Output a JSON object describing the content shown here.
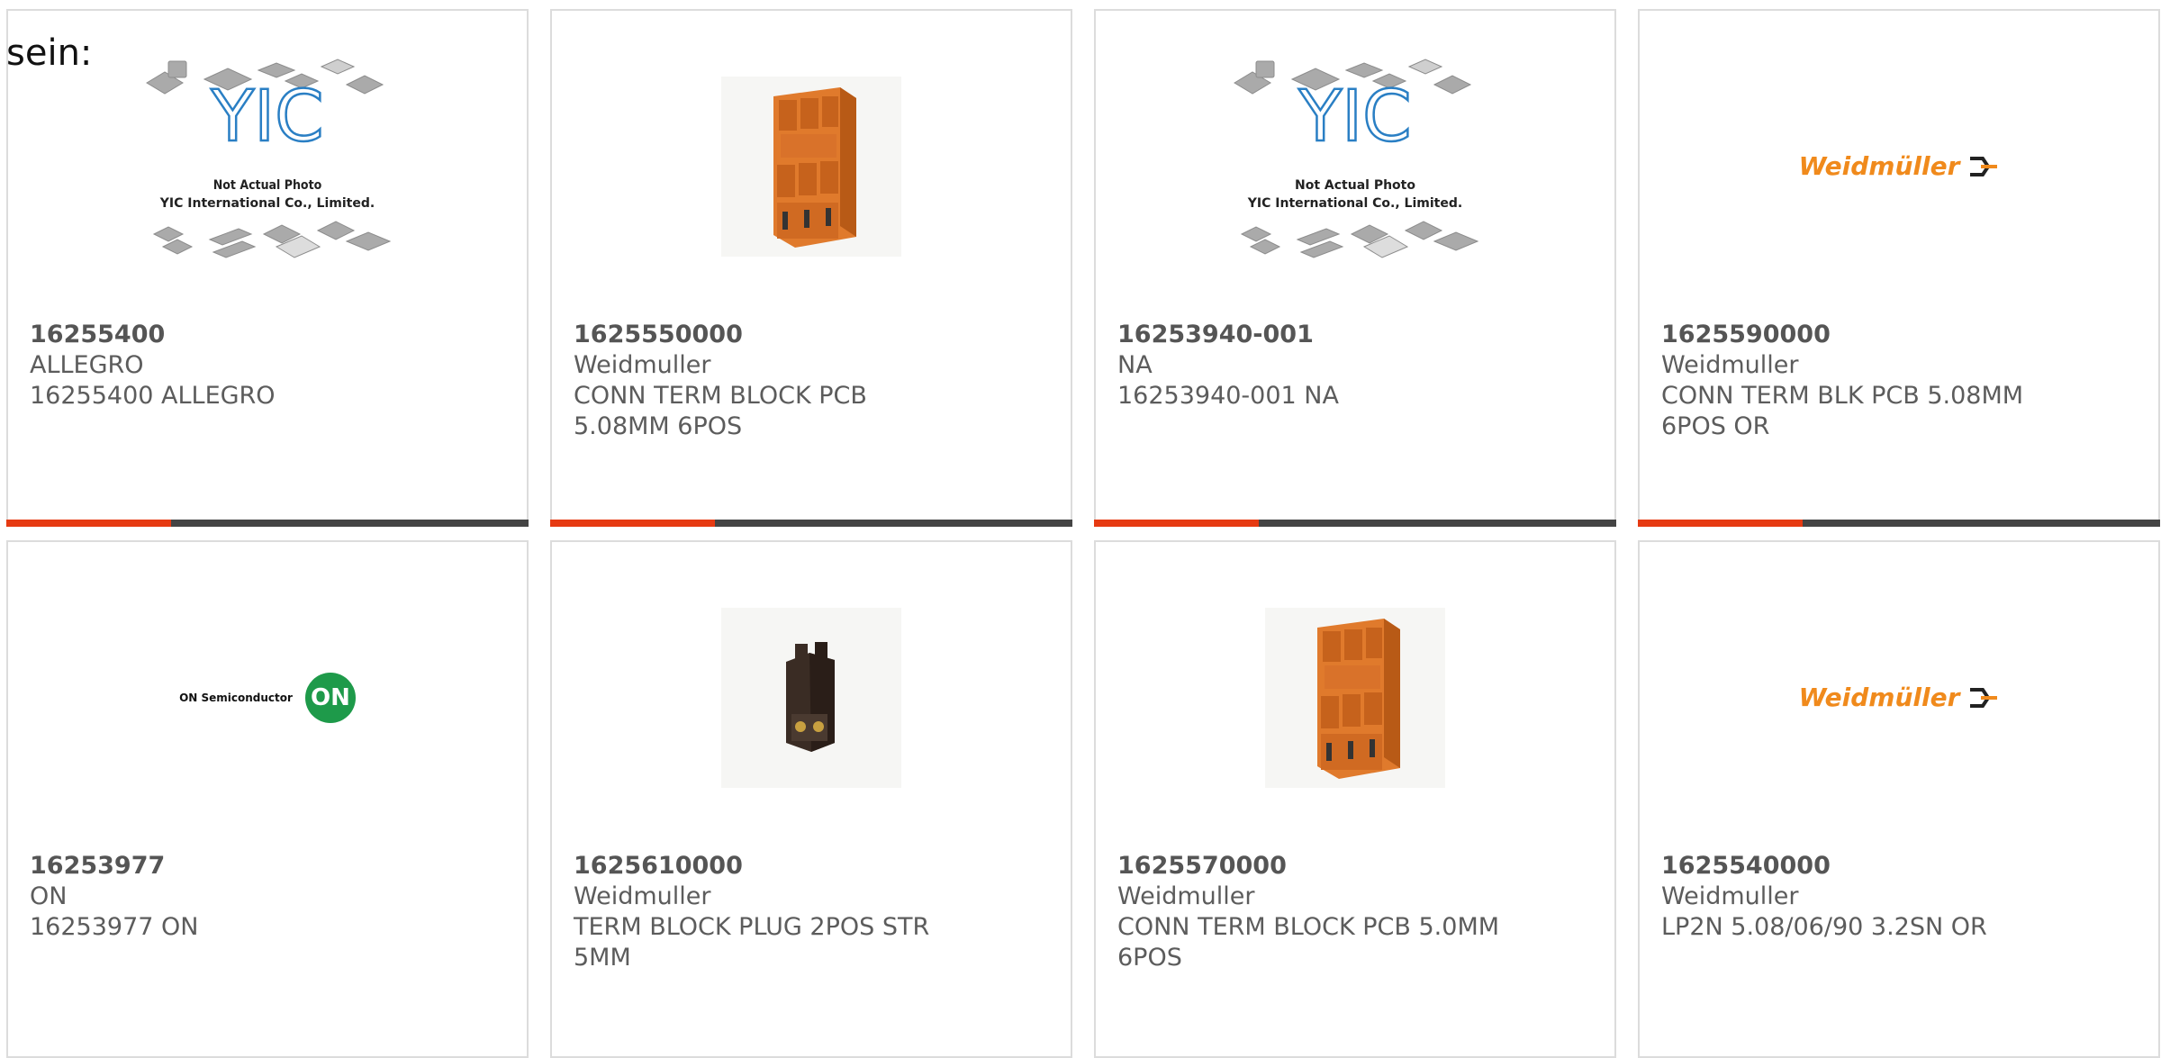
{
  "intro_text": "sein:",
  "products": [
    {
      "part_number": "16255400",
      "manufacturer": "ALLEGRO",
      "description": "16255400 ALLEGRO",
      "image": "yic-not-actual-photo",
      "image_caption_1": "Not Actual Photo",
      "image_caption_2": "YIC International Co., Limited."
    },
    {
      "part_number": "1625550000",
      "manufacturer": "Weidmuller",
      "description": "CONN TERM BLOCK PCB 5.08MM 6POS",
      "image": "orange-terminal-block"
    },
    {
      "part_number": "16253940-001",
      "manufacturer": "NA",
      "description": "16253940-001 NA",
      "image": "yic-not-actual-photo",
      "image_caption_1": "Not Actual Photo",
      "image_caption_2": "YIC International Co., Limited."
    },
    {
      "part_number": "1625590000",
      "manufacturer": "Weidmuller",
      "description": "CONN TERM BLK PCB 5.08MM 6POS OR",
      "image": "weidmuller-logo",
      "logo_text": "Weidmüller"
    },
    {
      "part_number": "16253977",
      "manufacturer": "ON",
      "description": "16253977 ON",
      "image": "on-semiconductor-logo",
      "logo_text": "ON Semiconductor",
      "logo_mark": "ON"
    },
    {
      "part_number": "1625610000",
      "manufacturer": "Weidmuller",
      "description": "TERM BLOCK PLUG 2POS STR 5MM",
      "image": "black-plug-connector"
    },
    {
      "part_number": "1625570000",
      "manufacturer": "Weidmuller",
      "description": "CONN TERM BLOCK PCB 5.0MM 6POS",
      "image": "orange-terminal-block"
    },
    {
      "part_number": "1625540000",
      "manufacturer": "Weidmuller",
      "description": "LP2N 5.08/06/90 3.2SN OR",
      "image": "weidmuller-logo",
      "logo_text": "Weidmüller"
    }
  ],
  "colors": {
    "accent": "#e63a12",
    "bar": "#444444",
    "border": "#dcdcdc",
    "text": "#5c5c5c",
    "orange_block": "#e07a2c",
    "weidmuller_orange": "#f08a1c",
    "on_green": "#1e9a4a"
  }
}
